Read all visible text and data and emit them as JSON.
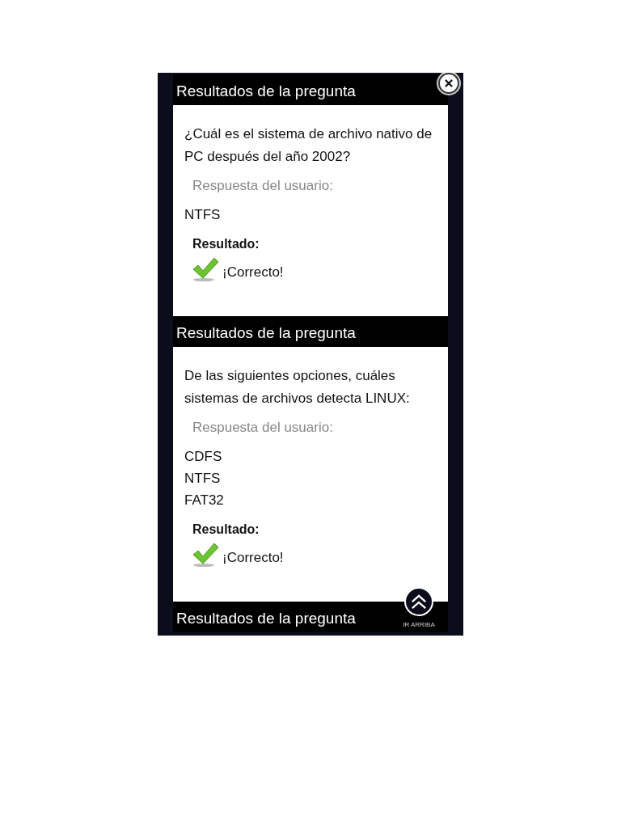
{
  "results": [
    {
      "header": "Resultados de la pregunta",
      "question": "¿Cuál es el sistema de archivo nativo de PC después del año 2002?",
      "answer_label": "Respuesta del usuario:",
      "answers": [
        "NTFS"
      ],
      "result_label": "Resultado:",
      "result": "¡Correcto!",
      "correct": true
    },
    {
      "header": "Resultados de la pregunta",
      "question": "De las siguientes opciones, cuáles sistemas de archivos detecta LINUX:",
      "answer_label": "Respuesta del usuario:",
      "answers": [
        "CDFS",
        "NTFS",
        "FAT32"
      ],
      "result_label": "Resultado:",
      "result": "¡Correcto!",
      "correct": true
    }
  ],
  "next_header": "Resultados de la pregunta",
  "scroll_top": {
    "label": "IR ARRIBA"
  }
}
